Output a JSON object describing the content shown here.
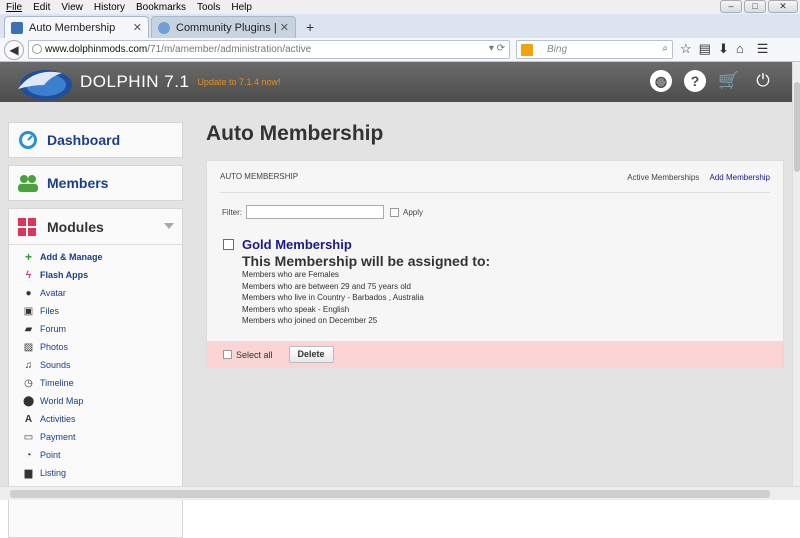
{
  "menubar": {
    "items": [
      "File",
      "Edit",
      "View",
      "History",
      "Bookmarks",
      "Tools",
      "Help"
    ]
  },
  "window_controls": [
    "–",
    "□",
    "✕"
  ],
  "tabs": [
    {
      "label": "Auto Membership",
      "active": true
    },
    {
      "label": "Community Plugins | Social...",
      "active": false
    }
  ],
  "tabbar": {
    "new_tab": "+"
  },
  "nav": {
    "url_host": "www.dolphinmods.com",
    "url_path": "/71/m/amember/administration/active",
    "search_placeholder": "Bing"
  },
  "header": {
    "brand": "DOLPHIN 7.1",
    "update_text": "Update to 7.1.4 now!"
  },
  "sidebar": {
    "dashboard": "Dashboard",
    "members": "Members",
    "modules": "Modules",
    "module_items": [
      {
        "label": "Add & Manage",
        "icon": "plus-icon"
      },
      {
        "label": "Flash Apps",
        "icon": "flash-icon"
      },
      {
        "label": "Avatar",
        "icon": "user-icon"
      },
      {
        "label": "Files",
        "icon": "save-icon"
      },
      {
        "label": "Forum",
        "icon": "comments-icon"
      },
      {
        "label": "Photos",
        "icon": "picture-icon"
      },
      {
        "label": "Sounds",
        "icon": "music-icon"
      },
      {
        "label": "Timeline",
        "icon": "timeline-icon"
      },
      {
        "label": "World Map",
        "icon": "map-marker-icon"
      },
      {
        "label": "Activities",
        "icon": "activity-icon"
      },
      {
        "label": "Payment",
        "icon": "credit-card-icon"
      },
      {
        "label": "Point",
        "icon": "point-icon"
      },
      {
        "label": "Listing",
        "icon": "briefcase-icon"
      }
    ]
  },
  "main": {
    "title": "Auto Membership",
    "panel_title": "AUTO MEMBERSHIP",
    "links": [
      "Active Memberships",
      "Add Membership"
    ],
    "filter_label": "Filter:",
    "filter_value": "",
    "apply_label": "Apply",
    "membership": {
      "name": "Gold Membership",
      "subtitle": "This Membership will be assigned to:",
      "criteria": [
        "Members who are Females",
        "Members who are between 29 and 75 years old",
        "Members who live in Country - Barbados , Australia",
        "Members who speak - English",
        "Members who joined on December 25"
      ]
    },
    "select_all": "Select all",
    "delete": "Delete"
  },
  "colors": {
    "link": "#1a3f8a",
    "accent": "#e8901a",
    "header_bg": "#5a5a5a",
    "footer_bg": "#fbd5d5"
  }
}
